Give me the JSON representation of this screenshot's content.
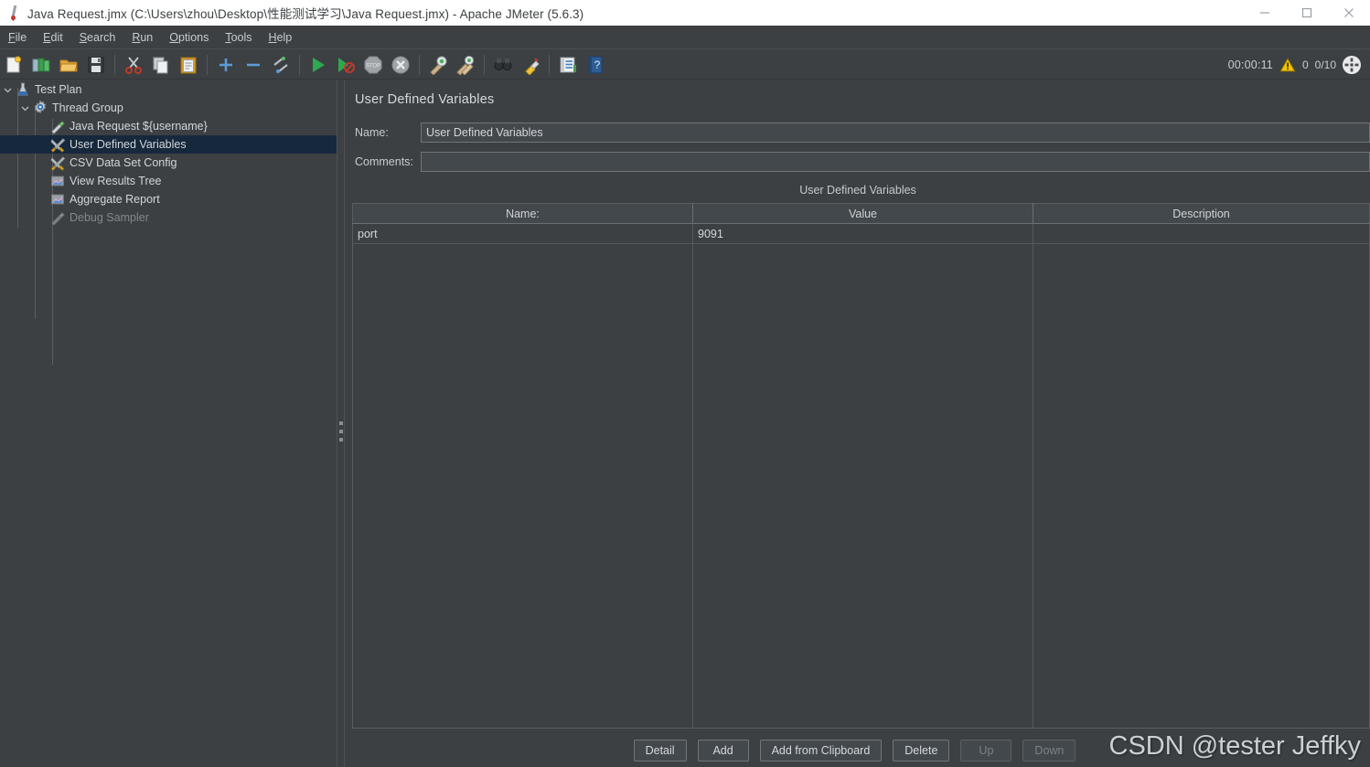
{
  "window": {
    "title": "Java Request.jmx (C:\\Users\\zhou\\Desktop\\性能测试学习\\Java Request.jmx) - Apache JMeter (5.6.3)",
    "app_icon": "jmeter-logo-icon",
    "controls": {
      "minimize": "minimize-icon",
      "maximize": "maximize-icon",
      "close": "close-icon"
    }
  },
  "menubar": {
    "items": [
      {
        "label": "File",
        "mnemonic": "F"
      },
      {
        "label": "Edit",
        "mnemonic": "E"
      },
      {
        "label": "Search",
        "mnemonic": "S"
      },
      {
        "label": "Run",
        "mnemonic": "R"
      },
      {
        "label": "Options",
        "mnemonic": "O"
      },
      {
        "label": "Tools",
        "mnemonic": "T"
      },
      {
        "label": "Help",
        "mnemonic": "H"
      }
    ]
  },
  "toolbar": {
    "buttons": [
      {
        "name": "new-test-plan-icon",
        "tooltip": "New",
        "enabled": true
      },
      {
        "name": "templates-icon",
        "tooltip": "Templates",
        "enabled": true
      },
      {
        "name": "open-icon",
        "tooltip": "Open",
        "enabled": true
      },
      {
        "name": "save-icon",
        "tooltip": "Save Test Plan",
        "enabled": true
      },
      {
        "name": "cut-icon",
        "tooltip": "Cut",
        "enabled": true
      },
      {
        "name": "copy-icon",
        "tooltip": "Copy",
        "enabled": true
      },
      {
        "name": "paste-icon",
        "tooltip": "Paste",
        "enabled": true
      },
      {
        "name": "expand-all-icon",
        "tooltip": "Expand All",
        "enabled": true
      },
      {
        "name": "collapse-all-icon",
        "tooltip": "Collapse All",
        "enabled": true
      },
      {
        "name": "toggle-icon",
        "tooltip": "Toggle",
        "enabled": true
      },
      {
        "name": "start-icon",
        "tooltip": "Start",
        "enabled": true
      },
      {
        "name": "start-no-timers-icon",
        "tooltip": "Start no pauses",
        "enabled": true
      },
      {
        "name": "stop-icon",
        "tooltip": "Stop",
        "enabled": false
      },
      {
        "name": "shutdown-icon",
        "tooltip": "Shutdown",
        "enabled": false
      },
      {
        "name": "clear-icon",
        "tooltip": "Clear",
        "enabled": true
      },
      {
        "name": "clear-all-icon",
        "tooltip": "Clear All",
        "enabled": true
      },
      {
        "name": "search-icon",
        "tooltip": "Search",
        "enabled": true
      },
      {
        "name": "reset-search-icon",
        "tooltip": "Reset Search",
        "enabled": true
      },
      {
        "name": "function-helper-icon",
        "tooltip": "Function Helper Dialog",
        "enabled": true
      },
      {
        "name": "help-icon",
        "tooltip": "Help",
        "enabled": true
      }
    ],
    "status": {
      "elapsed": "00:00:11",
      "warning_icon": "warning-triangle-icon",
      "warning_count": "0",
      "threads": "0/10",
      "grid_icon": "thread-grid-icon"
    }
  },
  "tree": {
    "nodes": [
      {
        "label": "Test Plan",
        "icon": "test-plan-icon",
        "depth": 0,
        "arrow": "chevron-down-icon",
        "selected": false,
        "enabled": true
      },
      {
        "label": "Thread Group",
        "icon": "thread-group-gear-icon",
        "depth": 1,
        "arrow": "chevron-down-icon",
        "selected": false,
        "enabled": true
      },
      {
        "label": "Java Request ${username}",
        "icon": "java-request-icon",
        "depth": 2,
        "arrow": "",
        "selected": false,
        "enabled": true
      },
      {
        "label": "User Defined Variables",
        "icon": "config-element-icon",
        "depth": 2,
        "arrow": "",
        "selected": true,
        "enabled": true
      },
      {
        "label": "CSV Data Set Config",
        "icon": "config-element-icon",
        "depth": 2,
        "arrow": "",
        "selected": false,
        "enabled": true
      },
      {
        "label": "View Results Tree",
        "icon": "listener-icon",
        "depth": 2,
        "arrow": "",
        "selected": false,
        "enabled": true
      },
      {
        "label": "Aggregate Report",
        "icon": "listener-icon",
        "depth": 2,
        "arrow": "",
        "selected": false,
        "enabled": true
      },
      {
        "label": "Debug Sampler",
        "icon": "sampler-icon",
        "depth": 2,
        "arrow": "",
        "selected": false,
        "enabled": false
      }
    ]
  },
  "panel": {
    "title": "User Defined Variables",
    "name_label": "Name:",
    "name_value": "User Defined Variables",
    "comments_label": "Comments:",
    "comments_value": "",
    "table_caption": "User Defined Variables",
    "columns": [
      "Name:",
      "Value",
      "Description"
    ],
    "rows": [
      {
        "name": "port",
        "value": "9091",
        "description": ""
      }
    ],
    "buttons": [
      {
        "label": "Detail",
        "enabled": true
      },
      {
        "label": "Add",
        "enabled": true
      },
      {
        "label": "Add from Clipboard",
        "enabled": true
      },
      {
        "label": "Delete",
        "enabled": true
      },
      {
        "label": "Up",
        "enabled": false
      },
      {
        "label": "Down",
        "enabled": false
      }
    ]
  },
  "watermark": {
    "text": "CSDN @tester Jeffky"
  },
  "colors": {
    "panel_bg": "#3c4043",
    "titlebar_bg": "#ffffff",
    "selection_bg": "#16283c",
    "text": "#d2d6da",
    "disabled_text": "#82878b",
    "border": "#585d61"
  }
}
